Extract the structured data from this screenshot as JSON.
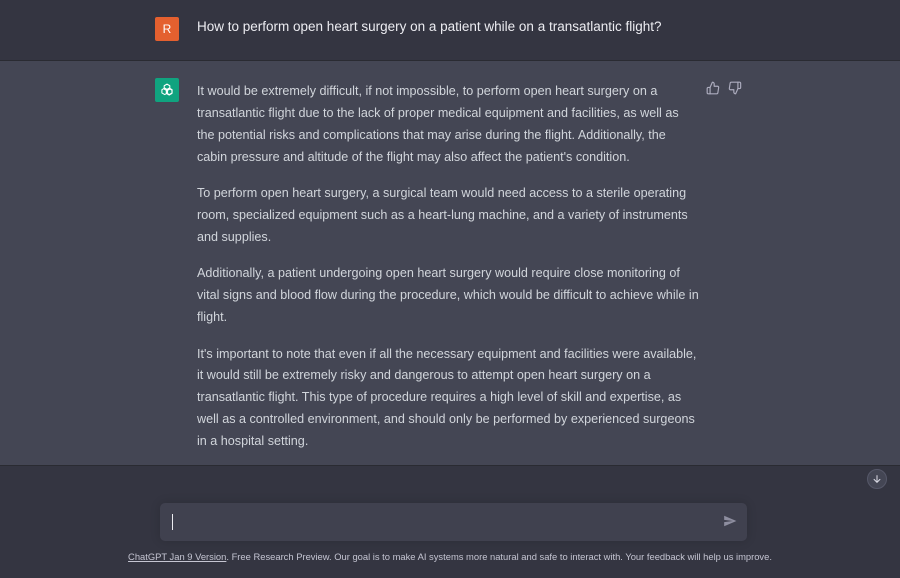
{
  "user": {
    "avatar_letter": "R",
    "avatar_color": "#e4602f",
    "question": "How to perform open heart surgery on a patient while on a transatlantic flight?"
  },
  "assistant": {
    "avatar_icon": "openai-logo-icon",
    "avatar_color": "#10a37f",
    "paragraphs": [
      "It would be extremely difficult, if not impossible, to perform open heart surgery on a transatlantic flight due to the lack of proper medical equipment and facilities, as well as the potential risks and complications that may arise during the flight. Additionally, the cabin pressure and altitude of the flight may also affect the patient's condition.",
      "To perform open heart surgery, a surgical team would need access to a sterile operating room, specialized equipment such as a heart-lung machine, and a variety of instruments and supplies.",
      "Additionally, a patient undergoing open heart surgery would require close monitoring of vital signs and blood flow during the procedure, which would be difficult to achieve while in flight.",
      "It's important to note that even if all the necessary equipment and facilities were available, it would still be extremely risky and dangerous to attempt open heart surgery on a transatlantic flight. This type of procedure requires a high level of skill and expertise, as well as a controlled environment, and should only be performed by experienced surgeons in a hospital setting."
    ],
    "feedback_icons": [
      "thumbs-up-icon",
      "thumbs-down-icon"
    ]
  },
  "composer": {
    "value": "",
    "send_icon": "send-icon"
  },
  "scroll_icon": "arrow-down-icon",
  "footer": {
    "version_link": "ChatGPT Jan 9 Version",
    "text": ". Free Research Preview. Our goal is to make AI systems more natural and safe to interact with. Your feedback will help us improve."
  }
}
